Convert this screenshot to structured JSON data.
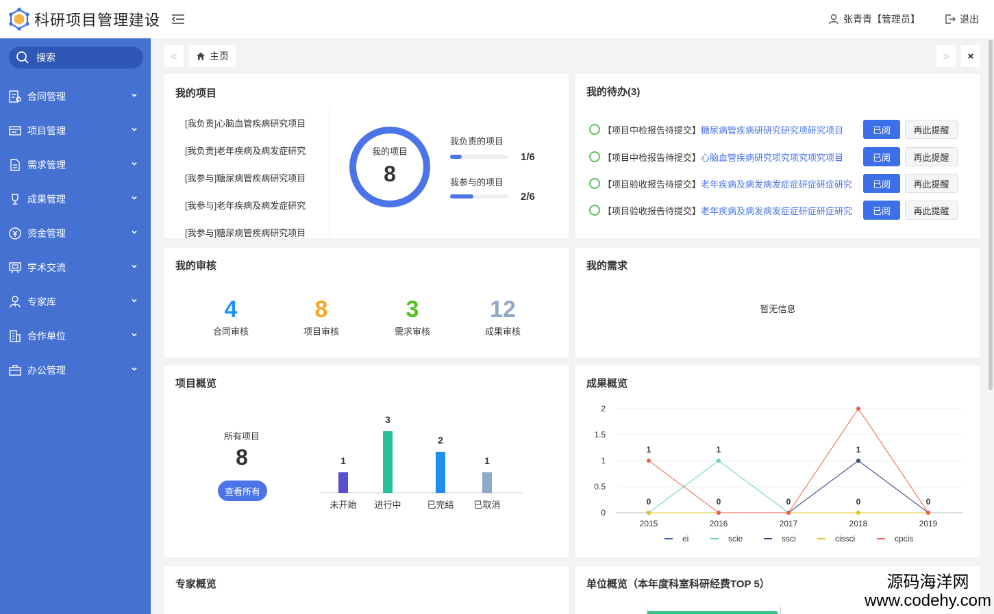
{
  "header": {
    "title": "科研项目管理建设",
    "user": "张青青【管理员】",
    "logout": "退出"
  },
  "sidebar": {
    "search_label": "搜索",
    "items": [
      {
        "label": "合同管理",
        "icon": "contract-icon"
      },
      {
        "label": "项目管理",
        "icon": "project-icon"
      },
      {
        "label": "需求管理",
        "icon": "document-icon"
      },
      {
        "label": "成果管理",
        "icon": "trophy-icon"
      },
      {
        "label": "资金管理",
        "icon": "yuan-icon"
      },
      {
        "label": "学术交流",
        "icon": "presentation-icon"
      },
      {
        "label": "专家库",
        "icon": "expert-icon"
      },
      {
        "label": "合作单位",
        "icon": "building-icon"
      },
      {
        "label": "办公管理",
        "icon": "briefcase-icon"
      }
    ]
  },
  "tabs": {
    "prev": "<",
    "next": ">",
    "home": "主页",
    "close": "×"
  },
  "my_projects": {
    "title": "我的项目",
    "list": [
      "[我负责]心脑血管疾病研究项目",
      "[我负责]老年疾病及病发症研究",
      "[我参与]糖尿病管疾病研究项目",
      "[我参与]老年疾病及病发症研究",
      "[我参与]糖尿病管疾病研究项目"
    ],
    "ring_label": "我的项目",
    "ring_value": "8",
    "responsible_label": "我负责的项目",
    "responsible_value": "1/6",
    "responsible_fraction": 0.2,
    "participate_label": "我参与的项目",
    "participate_value": "2/6",
    "participate_fraction": 0.4
  },
  "todos": {
    "title": "我的待办(3)",
    "items": [
      {
        "tag": "【项目中检报告待提交】",
        "link": "糖尿病管疾病研研究研究项研究项目"
      },
      {
        "tag": "【项目中检报告待提交】",
        "link": "心脑血管疾病研究项究项究项究项目"
      },
      {
        "tag": "【项目验收报告待提交】",
        "link": "老年疾病及病发病发症症研症研症研究"
      },
      {
        "tag": "【项目验收报告待提交】",
        "link": "老年疾病及病发病发症症研症研症研究"
      }
    ],
    "read_label": "已阅",
    "remind_label": "再此提醒"
  },
  "reviews": {
    "title": "我的审核",
    "items": [
      {
        "value": "4",
        "label": "合同审核",
        "color": "#1e90ff"
      },
      {
        "value": "8",
        "label": "项目审核",
        "color": "#f5a623"
      },
      {
        "value": "3",
        "label": "需求审核",
        "color": "#52c41a"
      },
      {
        "value": "12",
        "label": "成果审核",
        "color": "#8eaac8"
      }
    ]
  },
  "demands": {
    "title": "我的需求",
    "empty": "暂无信息"
  },
  "project_overview": {
    "title": "项目概览",
    "all_label": "所有项目",
    "all_value": "8",
    "view_all": "查看所有"
  },
  "achievement_overview": {
    "title": "成果概览"
  },
  "expert_overview": {
    "title": "专家概览"
  },
  "unit_overview": {
    "title": "单位概览（本年度科室科研经费TOP 5）"
  },
  "watermark": {
    "line1": "源码海洋网",
    "line2": "www.codehy.com"
  },
  "chart_data": [
    {
      "type": "bar",
      "categories": [
        "未开始",
        "进行中",
        "已完结",
        "已取消"
      ],
      "values": [
        1,
        3,
        2,
        1
      ],
      "colors": [
        "#5a4fcf",
        "#26c29a",
        "#1e8ff0",
        "#8eaac8"
      ]
    },
    {
      "type": "line",
      "x": [
        "2015",
        "2016",
        "2017",
        "2018",
        "2019"
      ],
      "ylim": [
        0,
        2
      ],
      "yticks": [
        "0",
        "0.5",
        "1",
        "1.5",
        "2"
      ],
      "grid": true,
      "legend": "bottom",
      "series": [
        {
          "name": "ei",
          "values": [
            0,
            0,
            0,
            1,
            0
          ],
          "color": "#3d5a9e"
        },
        {
          "name": "scie",
          "values": [
            0,
            1,
            0,
            0,
            0
          ],
          "color": "#5fd4b0"
        },
        {
          "name": "ssci",
          "values": [
            0,
            0,
            0,
            1,
            0
          ],
          "color": "#3d4e7a"
        },
        {
          "name": "cissci",
          "values": [
            0,
            0,
            0,
            0,
            0
          ],
          "color": "#e8c21c"
        },
        {
          "name": "cpcis",
          "values": [
            1,
            0,
            0,
            2,
            0
          ],
          "color": "#e8604c"
        }
      ],
      "point_labels": [
        {
          "x": "2015",
          "label": "1",
          "value": 1
        },
        {
          "x": "2015",
          "label": "0",
          "value": 0
        },
        {
          "x": "2016",
          "label": "1",
          "value": 1
        },
        {
          "x": "2016",
          "label": "0",
          "value": 0
        },
        {
          "x": "2017",
          "label": "0",
          "value": 0
        },
        {
          "x": "2018",
          "label": "1",
          "value": 1
        },
        {
          "x": "2018",
          "label": "0",
          "value": 0
        },
        {
          "x": "2019",
          "label": "0",
          "value": 0
        }
      ]
    }
  ]
}
